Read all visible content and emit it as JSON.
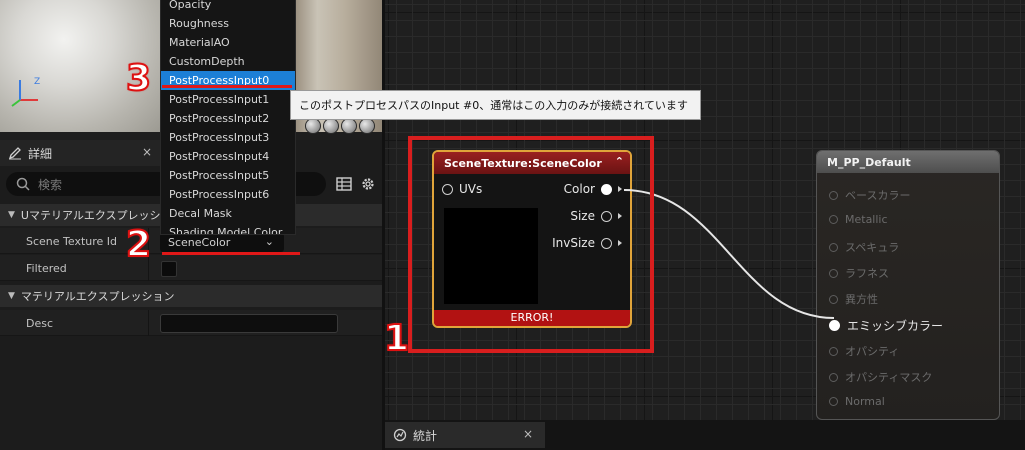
{
  "details": {
    "tab_label": "詳細",
    "tab_close": "×",
    "search_placeholder": "検索",
    "section1": "Uマテリアルエクスプレッション",
    "section2": "マテリアルエクスプレッション",
    "props": {
      "scene_texture_id_label": "Scene Texture Id",
      "scene_texture_id_value": "SceneColor",
      "filtered_label": "Filtered",
      "desc_label": "Desc"
    }
  },
  "dropdown": {
    "items": [
      "Opacity",
      "Roughness",
      "MaterialAO",
      "CustomDepth",
      "PostProcessInput0",
      "PostProcessInput1",
      "PostProcessInput2",
      "PostProcessInput3",
      "PostProcessInput4",
      "PostProcessInput5",
      "PostProcessInput6",
      "Decal Mask",
      "Shading Model Color"
    ],
    "selected_index": 4
  },
  "tooltip": "このポストプロセスパスのInput #0、通常はこの入力のみが接続されています",
  "annotations": [
    "1",
    "2",
    "3"
  ],
  "scene_texture_node": {
    "title": "SceneTexture:SceneColor",
    "input_pin": "UVs",
    "outputs": [
      "Color",
      "Size",
      "InvSize"
    ],
    "error": "ERROR!",
    "collapse_glyph": "⌃"
  },
  "material_node": {
    "title": "M_PP_Default",
    "pins": [
      "ベースカラー",
      "Metallic",
      "スペキュラ",
      "ラフネス",
      "異方性",
      "エミッシブカラー",
      "オパシティ",
      "オパシティマスク",
      "Normal"
    ],
    "active_pin_index": 5
  },
  "stats_tab": {
    "label": "統計",
    "close": "×"
  },
  "colors": {
    "selection": "#1c7fd6",
    "error": "#b21212",
    "annotation": "#d81e1e",
    "node_border": "#e0a43a"
  }
}
